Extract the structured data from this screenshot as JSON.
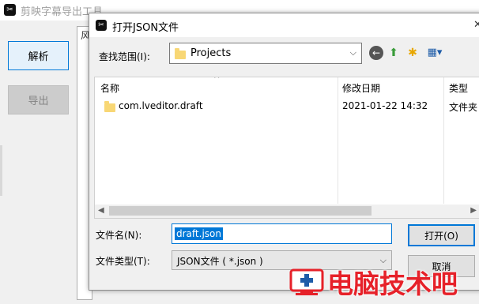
{
  "app": {
    "title": "剪映字幕导出工具",
    "parse_button": "解析",
    "export_button": "导出",
    "panel_fragment": "风"
  },
  "dialog": {
    "title": "打开JSON文件",
    "look_in_label": "查找范围(I):",
    "look_in_value": "Projects",
    "columns": {
      "name": "名称",
      "date": "修改日期",
      "type": "类型"
    },
    "files": [
      {
        "name": "com.lveditor.draft",
        "date": "2021-01-22 14:32",
        "type": "文件夹"
      }
    ],
    "file_name_label": "文件名(N):",
    "file_name_value": "draft.json",
    "file_type_label": "文件类型(T):",
    "file_type_value": "JSON文件 ( *.json )",
    "open_button": "打开(O)",
    "cancel_button": "取消"
  },
  "watermark": {
    "text": "电脑技术吧"
  },
  "icons": {
    "back": "back-arrow-icon",
    "up": "up-folder-icon",
    "new_folder": "new-folder-icon",
    "view_menu": "view-menu-icon"
  },
  "colors": {
    "accent": "#0078d7",
    "watermark": "#e62129",
    "folder": "#f8d775"
  }
}
